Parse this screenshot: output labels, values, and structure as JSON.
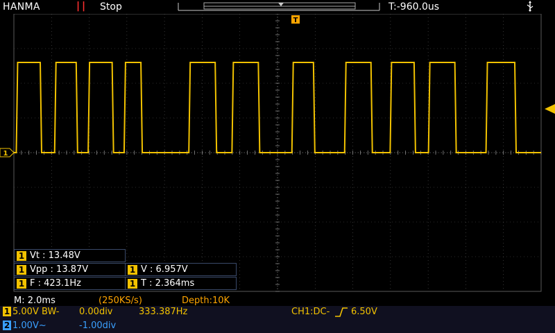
{
  "header": {
    "brand": "HANMA",
    "run_icon": "pause-icon",
    "run_state": "Stop",
    "trigger_time": "T:-960.0us",
    "usb_icon": "usb-icon"
  },
  "markers": {
    "trigger_position": "T",
    "channel1_ground": "1"
  },
  "colors": {
    "ch1": "#f2c200",
    "ch2": "#3aa0ff",
    "stop": "#ff3030",
    "grid": "#5a5a5a",
    "label": "#ffa500"
  },
  "measurements": {
    "vt": {
      "channel": "1",
      "text": "Vt : 13.48V"
    },
    "vpp": {
      "channel": "1",
      "text": "Vpp : 13.87V"
    },
    "v": {
      "channel": "1",
      "text": "V : 6.957V"
    },
    "f": {
      "channel": "1",
      "text": "F : 423.1Hz"
    },
    "t": {
      "channel": "1",
      "text": "T : 2.364ms"
    }
  },
  "status_line": {
    "timebase": "M: 2.0ms",
    "sample_rate": "(250KS/s)",
    "depth": "Depth:10K"
  },
  "channels": {
    "ch1": {
      "num": "1",
      "scale": "5.00V",
      "bw": "BW-",
      "offset": "0.00div",
      "freq": "333.387Hz"
    },
    "ch2": {
      "num": "2",
      "scale": "1.00V~",
      "offset": "-1.00div"
    }
  },
  "trigger": {
    "text": "CH1:DC-",
    "level": "6.50V",
    "slope_icon": "rising-edge-icon"
  },
  "waveform": {
    "channel": "1",
    "shape": "square",
    "high_div": 5.2,
    "low_div": 0.0,
    "edges_div": [
      0.05,
      0.55,
      0.85,
      1.3,
      1.55,
      2.05,
      2.3,
      2.65,
      3.65,
      4.2,
      4.55,
      5.1,
      5.8,
      6.25,
      6.9,
      7.45,
      7.85,
      8.35,
      8.65,
      9.2,
      9.85,
      10.45
    ]
  }
}
